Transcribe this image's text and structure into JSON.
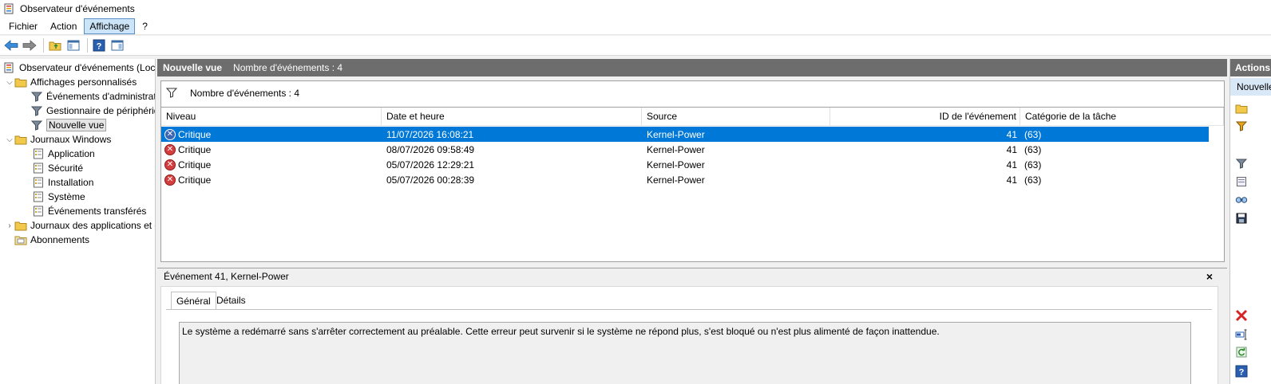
{
  "window": {
    "title": "Observateur d'événements"
  },
  "menu": [
    "Fichier",
    "Action",
    "Affichage",
    "?"
  ],
  "tree": {
    "root": "Observateur d'événements (Local)",
    "custom_views": "Affichages personnalisés",
    "admin_events": "Événements d'administration",
    "device_manager": "Gestionnaire de périphériques",
    "new_view": "Nouvelle vue",
    "windows_logs": "Journaux Windows",
    "application": "Application",
    "security": "Sécurité",
    "installation": "Installation",
    "system": "Système",
    "forwarded": "Événements transférés",
    "app_service_logs": "Journaux des applications et des services",
    "subscriptions": "Abonnements"
  },
  "view": {
    "title": "Nouvelle vue",
    "count_label": "Nombre d'événements : 4"
  },
  "filter": {
    "count_label": "Nombre d'événements : 4"
  },
  "grid": {
    "headers": [
      "Niveau",
      "Date et heure",
      "Source",
      "ID de l'événement",
      "Catégorie de la tâche"
    ],
    "rows": [
      {
        "level": "Critique",
        "date": "11/07/2026 16:08:21",
        "source": "Kernel-Power",
        "id": "41",
        "category": "(63)"
      },
      {
        "level": "Critique",
        "date": "08/07/2026 09:58:49",
        "source": "Kernel-Power",
        "id": "41",
        "category": "(63)"
      },
      {
        "level": "Critique",
        "date": "05/07/2026 12:29:21",
        "source": "Kernel-Power",
        "id": "41",
        "category": "(63)"
      },
      {
        "level": "Critique",
        "date": "05/07/2026 00:28:39",
        "source": "Kernel-Power",
        "id": "41",
        "category": "(63)"
      }
    ]
  },
  "detail": {
    "title": "Événement 41, Kernel-Power",
    "close": "×",
    "tabs": [
      "Général",
      "Détails"
    ],
    "description": "Le système a redémarré sans s'arrêter correctement au préalable. Cette erreur peut survenir si le système ne répond plus, s'est bloqué ou n'est plus alimenté de façon inattendue."
  },
  "actions": {
    "header": "Actions",
    "sub": "Nouvelle vue"
  },
  "colors": {
    "selection": "#0078d7",
    "header_gray": "#6d6d6d",
    "critical": "#d33f3f"
  }
}
